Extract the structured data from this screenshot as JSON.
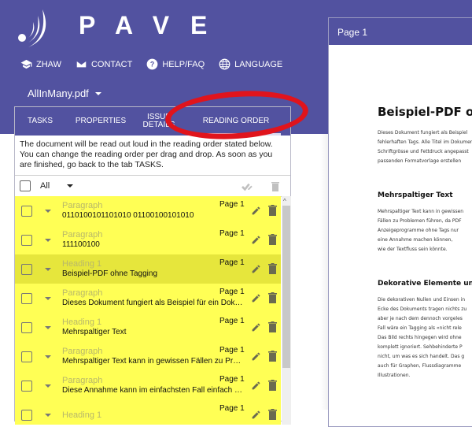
{
  "app": {
    "brand": "PAVE",
    "nav": [
      {
        "icon": "graduation-cap-icon",
        "label": "ZHAW"
      },
      {
        "icon": "envelope-icon",
        "label": "CONTACT"
      },
      {
        "icon": "help-circle-icon",
        "label": "HELP/FAQ"
      },
      {
        "icon": "globe-icon",
        "label": "LANGUAGE"
      }
    ],
    "file_name": "AllInMany.pdf"
  },
  "tabs": [
    {
      "label": "TASKS",
      "active": false
    },
    {
      "label": "PROPERTIES",
      "active": false
    },
    {
      "label": "ISSUE DETAILS",
      "active": false
    },
    {
      "label": "READING ORDER",
      "active": true
    }
  ],
  "reading_order": {
    "description": "The document will be read out loud in the reading order stated below. You can change the reading order per drag and drop. As soon as you are finished, go back to the tab TASKS.",
    "select_all_label": "All",
    "items": [
      {
        "type": "Paragraph",
        "content": "0110100101101010 01100100101010",
        "page": "Page 1",
        "highlighted": false
      },
      {
        "type": "Paragraph",
        "content": "111100100",
        "page": "Page 1",
        "highlighted": false
      },
      {
        "type": "Heading 1",
        "content": "Beispiel-PDF ohne Tagging",
        "page": "Page 1",
        "highlighted": true
      },
      {
        "type": "Paragraph",
        "content": "Dieses Dokument fungiert als Beispiel für ein Doku...",
        "page": "Page 1",
        "highlighted": false
      },
      {
        "type": "Heading 1",
        "content": "Mehrspaltiger Text",
        "page": "Page 1",
        "highlighted": false
      },
      {
        "type": "Paragraph",
        "content": "Mehrspaltiger Text kann in gewissen Fällen zu Prob...",
        "page": "Page 1",
        "highlighted": false
      },
      {
        "type": "Paragraph",
        "content": "Diese Annahme kann im einfachsten Fall einfach d...",
        "page": "Page 1",
        "highlighted": false
      },
      {
        "type": "Heading 1",
        "content": "",
        "page": "Page 1",
        "highlighted": false
      }
    ]
  },
  "viewer": {
    "header": "Page 1",
    "title": "Beispiel-PDF ohne Tagging",
    "intro": [
      "Dieses Dokument fungiert als Beispiel",
      "fehlerhaften Tags. Alle Titel im Dokument",
      "Schriftgrösse und Fettdruck angepasst",
      "passenden Formatvorlage erstellen"
    ],
    "section1_title": "Mehrspaltiger Text",
    "section1": [
      "Mehrspaltiger Text kann in gewissen",
      "Fällen zu Problemen führen, da PDF",
      "Anzeigeprogramme ohne Tags nur",
      "eine Annahme machen können,",
      "wie der Textfluss sein könnte."
    ],
    "section2_title": "Dekorative Elemente und",
    "section2": [
      "Die dekorativen Nullen und Einsen in",
      "Ecke des Dokuments tragen nichts zu",
      "aber je nach dem dennoch vorgeles",
      "Fall wäre ein Tagging als «nicht rele",
      "Das Bild rechts hingegen wird ohne",
      "komplett ignoriert. Sehbehinderte P",
      "nicht, um was es sich handelt. Das g",
      "auch für Graphen, Flussdiagramme",
      "Illustrationen."
    ]
  },
  "colors": {
    "brand": "#5252a0",
    "row_highlight": "#ffff55",
    "row_selected": "#e6e63c",
    "annotation": "#e0141c"
  }
}
